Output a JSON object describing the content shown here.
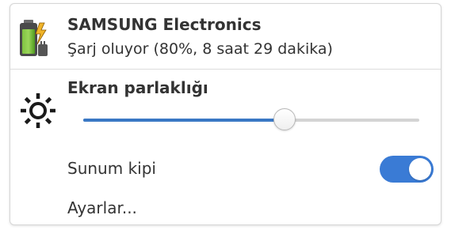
{
  "battery": {
    "device_name": "SAMSUNG Electronics",
    "status_text": "Şarj oluyor (80%, 8 saat 29 dakika)",
    "icon": "battery-charging-icon",
    "level_fraction": 0.8
  },
  "brightness": {
    "title": "Ekran parlaklığı",
    "icon": "brightness-sun-icon",
    "level_fraction": 0.6
  },
  "presentation_mode": {
    "label": "Sunum kipi",
    "enabled": true
  },
  "settings": {
    "label": "Ayarlar..."
  },
  "colors": {
    "accent": "#3a78c4",
    "toggle_on": "#3a7bd5",
    "battery_green": "#5aa02c"
  }
}
